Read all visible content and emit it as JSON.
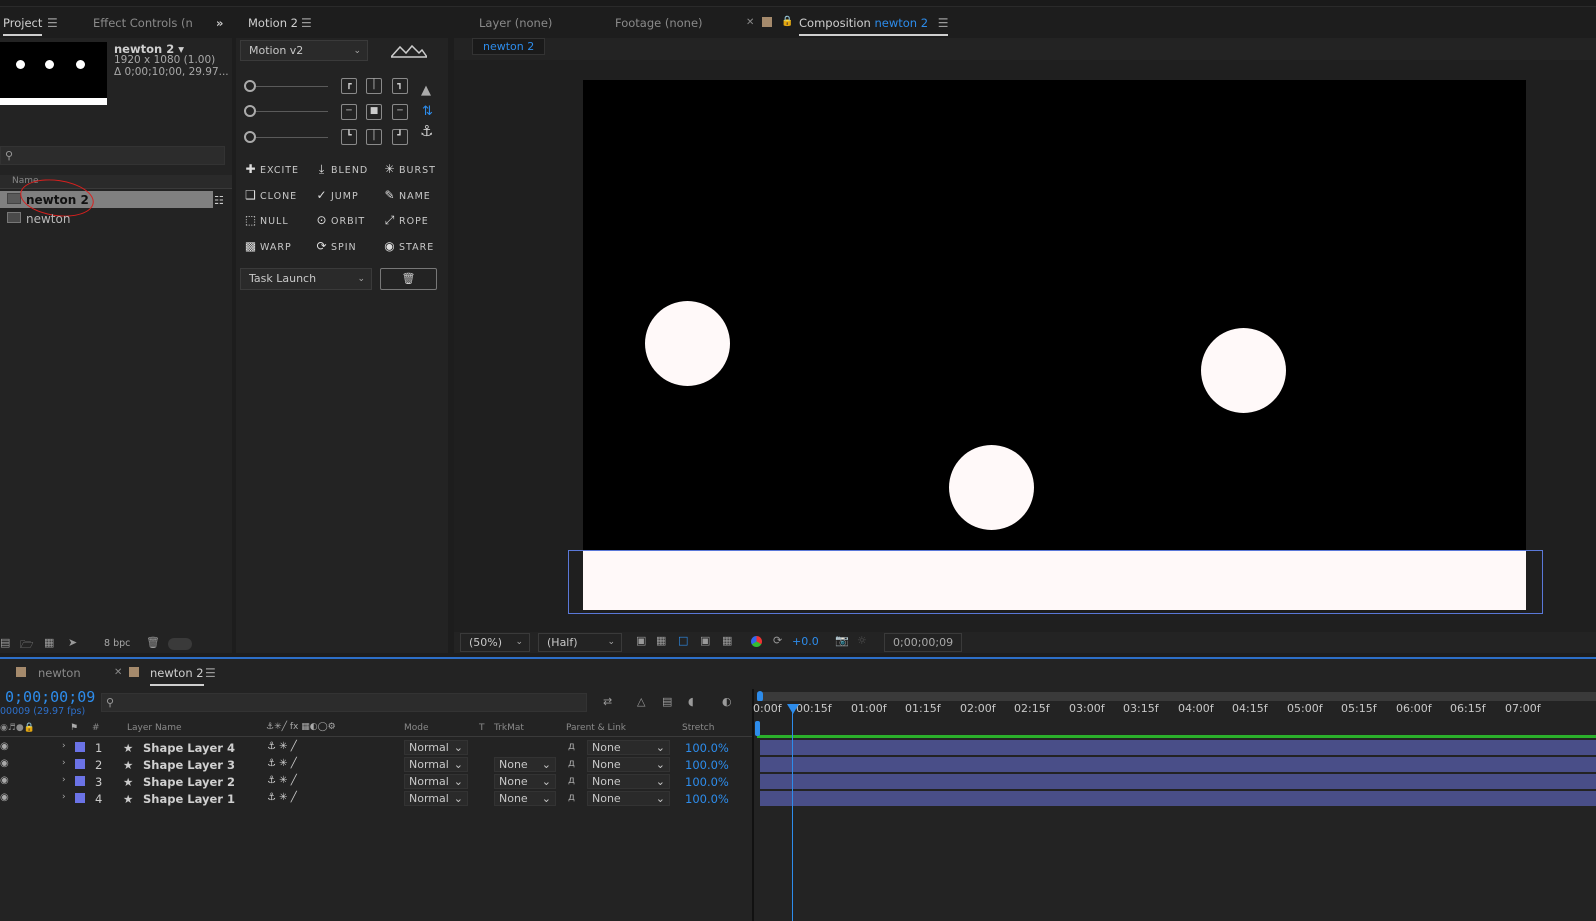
{
  "project_panel": {
    "tab_project": "Project",
    "tab_effect_controls": "Effect Controls (none",
    "comp_name": "newton 2 ▾",
    "comp_size": "1920 x 1080 (1.00)",
    "comp_duration": "Δ 0;00;10;00, 29.97...",
    "search_placeholder": "",
    "col_name": "Name",
    "items": [
      {
        "label": "newton 2",
        "selected": true
      },
      {
        "label": "newton",
        "selected": false
      }
    ],
    "bpc_label": "8 bpc"
  },
  "motion_panel": {
    "tab_title": "Motion 2",
    "preset_select": "Motion v2",
    "buttons": [
      "EXCITE",
      "BLEND",
      "BURST",
      "CLONE",
      "JUMP",
      "NAME",
      "NULL",
      "ORBIT",
      "ROPE",
      "WARP",
      "SPIN",
      "STARE"
    ],
    "task_select": "Task Launch"
  },
  "viewer": {
    "tab_layer": "Layer (none)",
    "tab_footage": "Footage (none)",
    "tab_composition_prefix": "Composition",
    "tab_composition_name": "newton 2",
    "breadcrumb": "newton 2",
    "zoom": "(50%)",
    "resolution": "(Half)",
    "exposure": "+0.0",
    "timecode": "0;00;00;09"
  },
  "timeline": {
    "tabs": [
      {
        "label": "newton",
        "active": false
      },
      {
        "label": "newton 2",
        "active": true
      }
    ],
    "current_time": "0;00;00;09",
    "frame_info": "00009 (29.97 fps)",
    "search_placeholder": "",
    "col_layer_name": "Layer Name",
    "col_mode": "Mode",
    "col_t": "T",
    "col_trkmat": "TrkMat",
    "col_parent": "Parent & Link",
    "col_stretch": "Stretch",
    "col_hash": "#",
    "layers": [
      {
        "num": "1",
        "name": "Shape Layer 4",
        "mode": "Normal",
        "trkmat": "",
        "parent": "None",
        "stretch": "100.0%"
      },
      {
        "num": "2",
        "name": "Shape Layer 3",
        "mode": "Normal",
        "trkmat": "None",
        "parent": "None",
        "stretch": "100.0%"
      },
      {
        "num": "3",
        "name": "Shape Layer 2",
        "mode": "Normal",
        "trkmat": "None",
        "parent": "None",
        "stretch": "100.0%"
      },
      {
        "num": "4",
        "name": "Shape Layer 1",
        "mode": "Normal",
        "trkmat": "None",
        "parent": "None",
        "stretch": "100.0%"
      }
    ],
    "ruler_ticks": [
      "0:00f",
      "00:15f",
      "01:00f",
      "01:15f",
      "02:00f",
      "02:15f",
      "03:00f",
      "03:15f",
      "04:00f",
      "04:15f",
      "05:00f",
      "05:15f",
      "06:00f",
      "06:15f",
      "07:00f"
    ]
  },
  "colors": {
    "accent_blue": "#2d8ceb",
    "layer_label": "#6b73e6",
    "layer_bar": "#494e88",
    "work_area_green": "#2bb02b",
    "annotation_red": "#d8201e"
  }
}
